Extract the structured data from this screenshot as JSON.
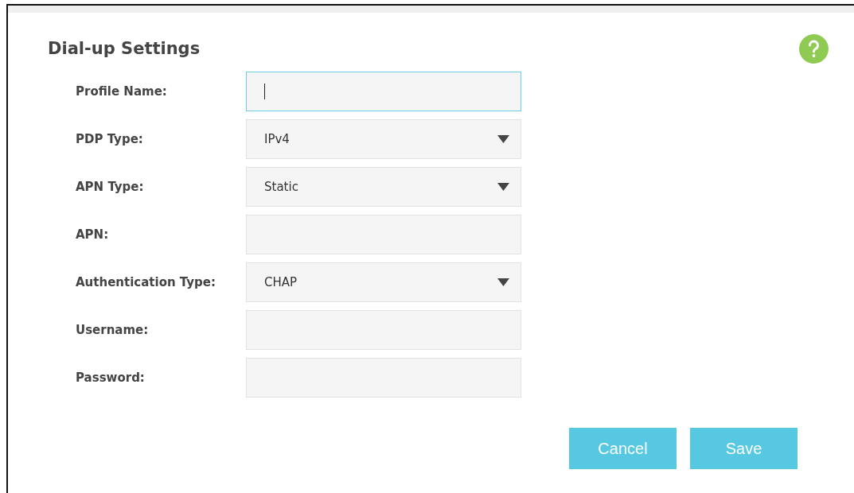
{
  "panel": {
    "title": "Dial-up Settings"
  },
  "fields": [
    {
      "label": "Profile Name:",
      "kind": "text",
      "focused": true
    },
    {
      "label": "PDP Type:",
      "kind": "select",
      "value": "IPv4"
    },
    {
      "label": "APN Type:",
      "kind": "select",
      "value": "Static"
    },
    {
      "label": "APN:",
      "kind": "text",
      "focused": false
    },
    {
      "label": "Authentication Type:",
      "kind": "select",
      "value": "CHAP"
    },
    {
      "label": "Username:",
      "kind": "text",
      "focused": false
    },
    {
      "label": "Password:",
      "kind": "text",
      "focused": false
    }
  ],
  "buttons": [
    "Cancel",
    "Save"
  ]
}
